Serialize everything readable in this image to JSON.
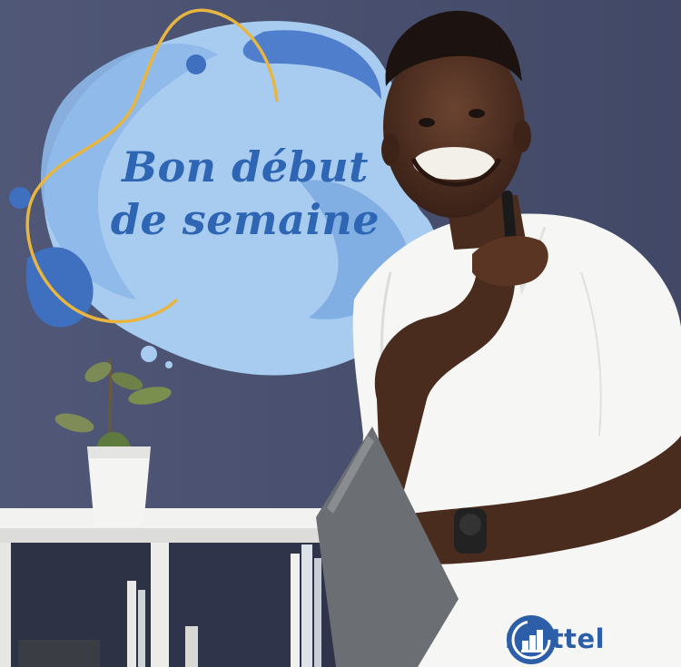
{
  "headline": {
    "line1": "Bon début",
    "line2": "de semaine"
  },
  "brand": {
    "name": "mattel",
    "logo_icon": "mattel-logo-icon"
  },
  "colors": {
    "wall": "#4a5170",
    "blob_light": "#a8ccef",
    "blob_mid": "#7aa8e0",
    "blob_dark": "#3f6fbf",
    "accent_line": "#e8b640",
    "headline_text": "#2f66b3",
    "brand_blue": "#2c5fa8",
    "shelf": "#f2f2f0",
    "shirt": "#f6f6f4"
  }
}
